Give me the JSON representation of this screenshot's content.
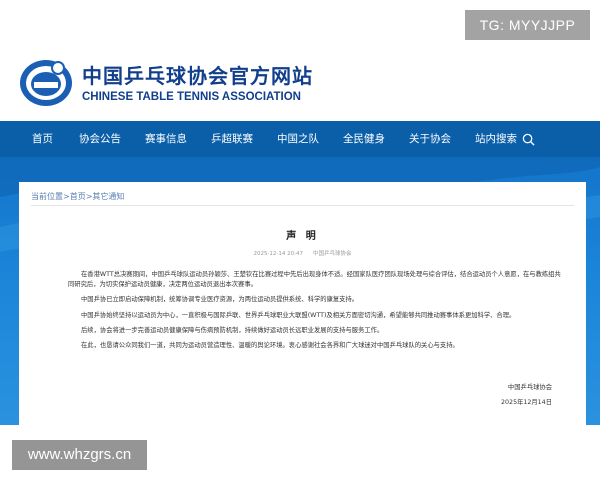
{
  "header": {
    "title_cn": "中国乒乓球协会官方网站",
    "title_en": "CHINESE TABLE TENNIS ASSOCIATION"
  },
  "watermark": {
    "tg": "TG: MYYJJPP",
    "site": "www.whzgrs.cn"
  },
  "nav": {
    "items": [
      "首页",
      "协会公告",
      "赛事信息",
      "乒超联赛",
      "中国之队",
      "全民健身",
      "关于协会",
      "站内搜索"
    ],
    "search_icon": "search-icon"
  },
  "breadcrumb": {
    "current": "当前位置",
    "sep": ">",
    "home": "首页",
    "category": "其它通知"
  },
  "article": {
    "title": "声 明",
    "date": "2025-12-14 20:47",
    "source": "中国乒乓球协会",
    "paragraphs": [
      "在香港WTT总决赛期间，中国乒乓球队运动员孙颖莎、王楚钦在比赛过程中先后出现身体不适。经国家队医疗团队现场处理与综合评估，结合运动员个人意愿，在与教练组共同研究后，为切实保护运动员健康，决定两位运动员退出本次赛事。",
      "中国乒协已立即启动保障机制，统筹协调专业医疗资源，为两位运动员提供系统、科学的康复支持。",
      "中国乒协始终坚持以运动员为中心，一直积极与国际乒联、世界乒乓球职业大联盟(WTT)及相关方面密切沟通，希望能够共同推动赛事体系更加科学、合理。",
      "后续，协会将进一步完善运动员健康保障与伤病预防机制，持续做好运动员长远职业发展的支持与服务工作。",
      "在此，也恳请公众同我们一道，共同为运动员营造理性、温暖的舆论环境。衷心感谢社会各界和广大球迷对中国乒乓球队的关心与支持。"
    ],
    "signature_org": "中国乒乓球协会",
    "signature_date": "2025年12月14日"
  },
  "colors": {
    "nav": "#0b5fa8",
    "brand": "#123f8c",
    "link": "#5a7fb0"
  }
}
